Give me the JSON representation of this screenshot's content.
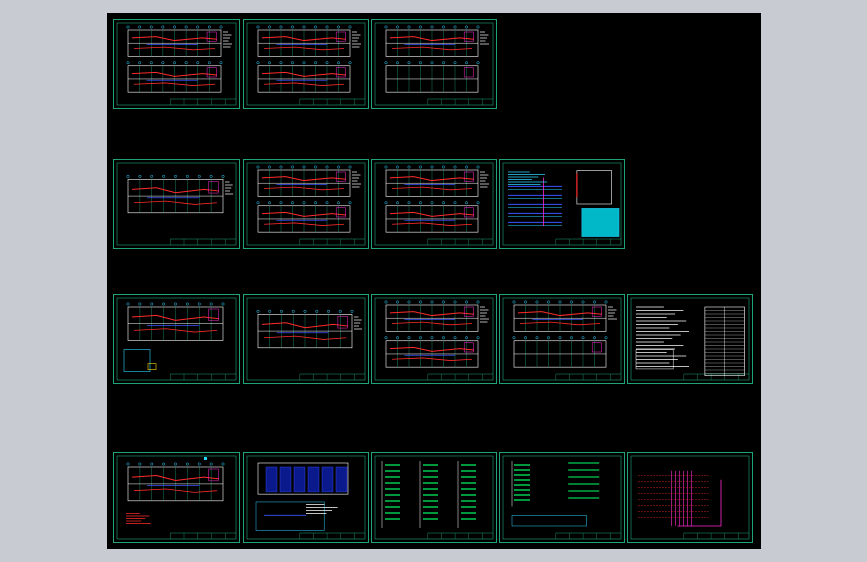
{
  "app": {
    "title": ""
  },
  "colors": {
    "viewport_bg": "#000000",
    "frame": "#1fa37a",
    "red": "#ff2b2b",
    "cyan": "#2ad4ff",
    "blue": "#3a52ff",
    "green": "#00ff66",
    "white": "#ffffff",
    "yellow": "#ffd400",
    "magenta": "#ff2bd0"
  },
  "sheets": [
    {
      "id": "s1",
      "kind": "plan2"
    },
    {
      "id": "s2",
      "kind": "plan2"
    },
    {
      "id": "s3",
      "kind": "plan2b"
    },
    {
      "id": "s4",
      "kind": "plan1"
    },
    {
      "id": "s5",
      "kind": "plan2"
    },
    {
      "id": "s6",
      "kind": "plan2"
    },
    {
      "id": "s7",
      "kind": "diagram"
    },
    {
      "id": "s8",
      "kind": "plan1detail"
    },
    {
      "id": "s9",
      "kind": "plan1"
    },
    {
      "id": "s10",
      "kind": "plan2"
    },
    {
      "id": "s11",
      "kind": "plan2b"
    },
    {
      "id": "s12",
      "kind": "notes"
    },
    {
      "id": "s13",
      "kind": "plan1legend"
    },
    {
      "id": "s14",
      "kind": "blueplan"
    },
    {
      "id": "s15",
      "kind": "schedule"
    },
    {
      "id": "s16",
      "kind": "schedule2"
    },
    {
      "id": "s17",
      "kind": "riser"
    }
  ]
}
